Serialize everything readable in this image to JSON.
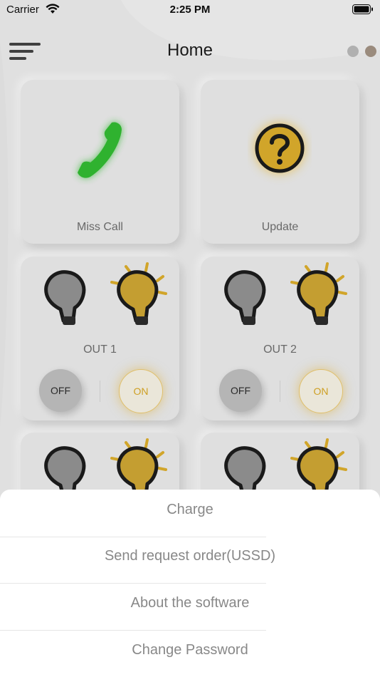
{
  "status_bar": {
    "carrier": "Carrier",
    "time": "2:25 PM"
  },
  "navbar": {
    "title": "Home",
    "menu_icon": "hamburger-menu-icon"
  },
  "cards": [
    {
      "label": "Miss Call",
      "icon": "phone-icon",
      "accent": "#2db92d"
    },
    {
      "label": "Update",
      "icon": "question-icon",
      "accent": "#d7a822"
    }
  ],
  "outputs": [
    {
      "label": "OUT 1",
      "off_label": "OFF",
      "on_label": "ON"
    },
    {
      "label": "OUT 2",
      "off_label": "OFF",
      "on_label": "ON"
    }
  ],
  "action_sheet": {
    "items": [
      "Charge",
      "Send request order(USSD)",
      "About the software",
      "Change Password"
    ]
  },
  "colors": {
    "bulb_on": "#c9a02a",
    "bulb_off": "#8b8b8b",
    "on_text": "#d4a11a"
  }
}
